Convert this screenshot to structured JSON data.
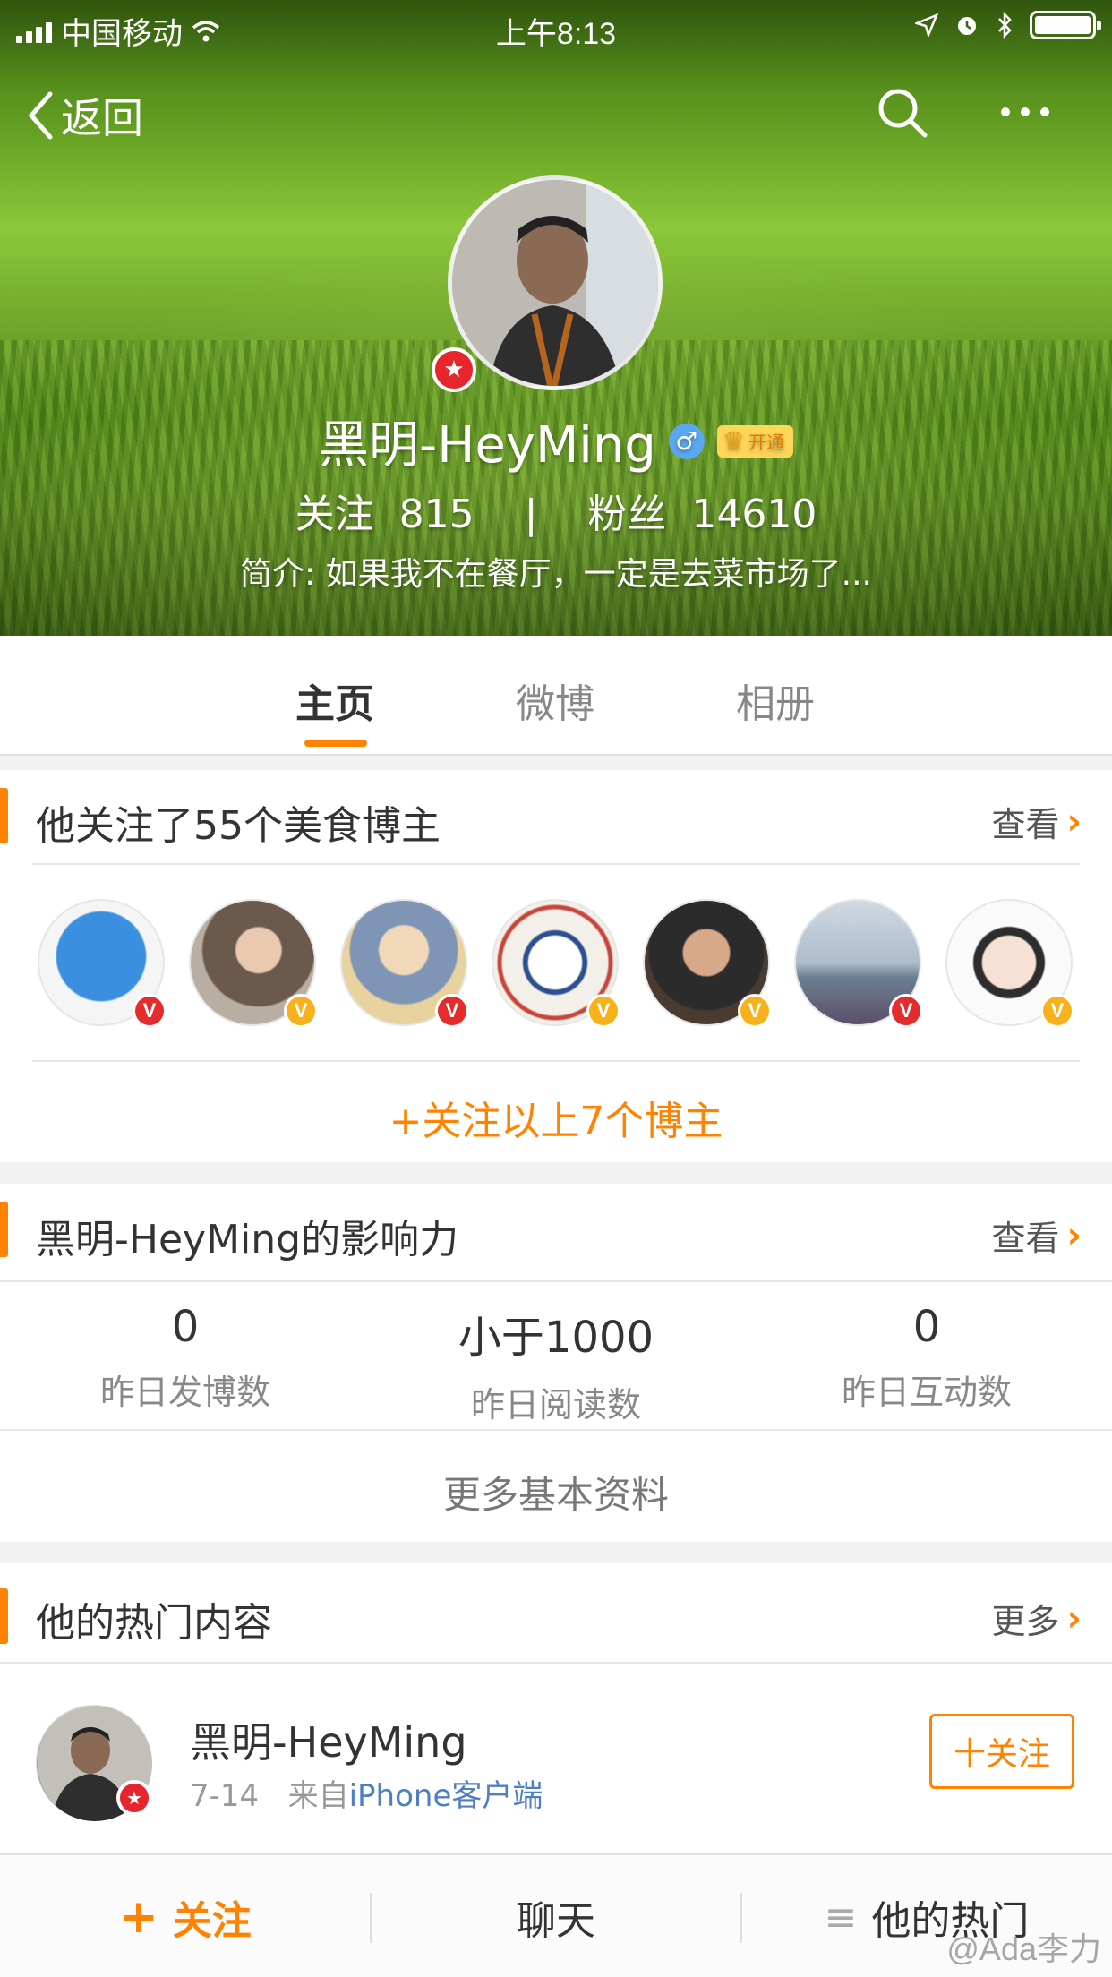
{
  "status_bar": {
    "carrier": "中国移动",
    "time": "上午8:13",
    "battery_level": 0.95
  },
  "nav": {
    "back_label": "返回",
    "search_icon": "search-icon",
    "more_icon": "more-icon"
  },
  "profile": {
    "name": "黑明-HeyMing",
    "gender_icon": "♂",
    "vip_label": "开通",
    "follow_label": "关注",
    "follow_count": "815",
    "separator": "|",
    "fans_label": "粉丝",
    "fans_count": "14610",
    "intro": "简介: 如果我不在餐厅，一定是去菜市场了..."
  },
  "tabs": [
    {
      "label": "主页",
      "active": true
    },
    {
      "label": "微博",
      "active": false
    },
    {
      "label": "相册",
      "active": false
    }
  ],
  "following_card": {
    "title": "他关注了55个美食博主",
    "link": "查看",
    "follow_all": "+关注以上7个博主",
    "avatars": [
      {
        "badge": "red",
        "color": "#3b8fe0"
      },
      {
        "badge": "gold",
        "color": "#8f7c6a"
      },
      {
        "badge": "red",
        "color": "#c9b79b"
      },
      {
        "badge": "gold",
        "color": "#f0e9e1"
      },
      {
        "badge": "gold",
        "color": "#4a3b30"
      },
      {
        "badge": "red",
        "color": "#9fb1c3"
      },
      {
        "badge": "gold",
        "color": "#f5f1ee"
      }
    ]
  },
  "influence_card": {
    "title": "黑明-HeyMing的影响力",
    "link": "查看",
    "metrics": [
      {
        "value": "0",
        "label": "昨日发博数"
      },
      {
        "value": "小于1000",
        "label": "昨日阅读数"
      },
      {
        "value": "0",
        "label": "昨日互动数"
      }
    ],
    "more": "更多基本资料"
  },
  "hot_card": {
    "title": "他的热门内容",
    "link": "更多",
    "post": {
      "author": "黑明-HeyMing",
      "date": "7-14",
      "from": "来自",
      "source": "iPhone客户端",
      "follow_btn": "十关注"
    }
  },
  "bottom_bar": {
    "follow_plus": "+",
    "follow": "关注",
    "chat": "聊天",
    "hot_icon": "≡",
    "hot": "他的热门"
  },
  "watermark": "@Ada李力",
  "colors": {
    "accent": "#ff8200",
    "link_blue": "#4e7fc1"
  }
}
